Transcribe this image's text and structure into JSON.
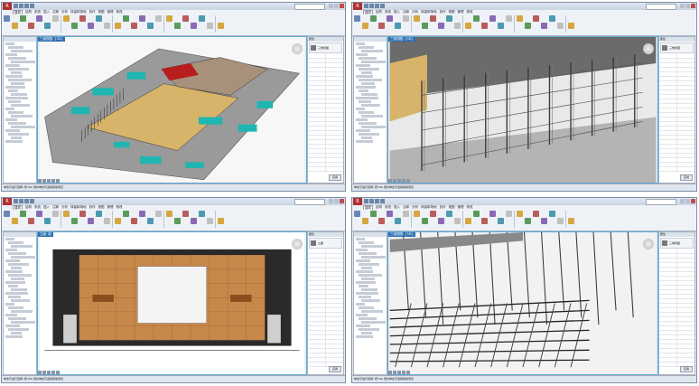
{
  "panels": [
    {
      "id": "top-left",
      "app_letter": "R",
      "viewport_tab": "三维视图: {3D}",
      "view_kind": "building-3d",
      "properties_header": "属性",
      "type_label": "三维视图",
      "apply_label": "应用",
      "status": "单击可进行选择; 按 Tab 键并单击可选择其他项目"
    },
    {
      "id": "top-right",
      "app_letter": "R",
      "viewport_tab": "三维视图: {3D}",
      "view_kind": "wall-frames",
      "properties_header": "属性",
      "type_label": "三维视图",
      "apply_label": "应用",
      "status": "单击可进行选择; 按 Tab 键并单击可选择其他项目"
    },
    {
      "id": "bottom-left",
      "app_letter": "R",
      "viewport_tab": "立面: 南",
      "view_kind": "elevation",
      "properties_header": "属性",
      "type_label": "立面",
      "apply_label": "应用",
      "status": "单击可进行选择; 按 Tab 键并单击可选择其他项目"
    },
    {
      "id": "bottom-right",
      "app_letter": "R",
      "viewport_tab": "三维视图: {3D}",
      "view_kind": "steel-grid",
      "properties_header": "属性",
      "type_label": "三维视图",
      "apply_label": "应用",
      "status": "单击可进行选择; 按 Tab 键并单击可选择其他项目"
    }
  ],
  "ribbon_tabs": [
    "建筑",
    "结构",
    "系统",
    "插入",
    "注释",
    "分析",
    "体量和场地",
    "协作",
    "视图",
    "管理",
    "修改"
  ],
  "colors": {
    "teal_ductwork": "#1fb5b0",
    "ceiling_wood": "#d8b36a",
    "stage_red": "#b81e1e",
    "floor_grey": "#8f8f8f",
    "panel_orange": "#c8884a",
    "screen_white": "#f4f4f4",
    "frame_dark": "#3a3a3a",
    "selection_border": "#5aa9d6"
  }
}
